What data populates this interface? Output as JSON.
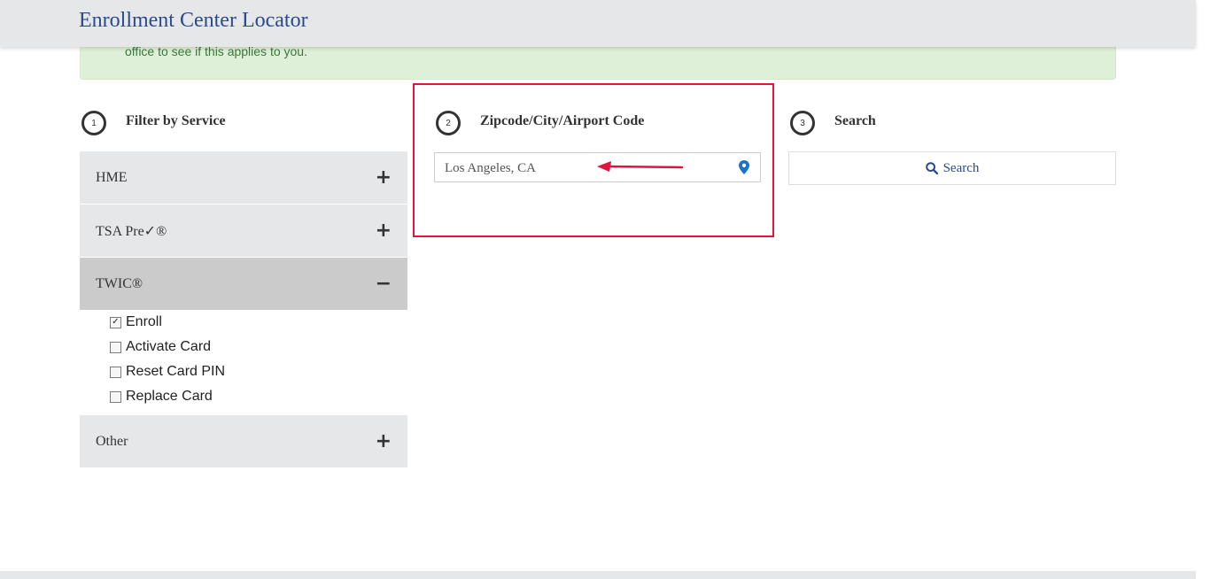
{
  "header": {
    "title": "Enrollment Center Locator"
  },
  "alert": {
    "text": "office to see if this applies to you."
  },
  "steps": [
    {
      "number": "1",
      "label": "Filter by Service"
    },
    {
      "number": "2",
      "label": "Zipcode/City/Airport Code"
    },
    {
      "number": "3",
      "label": "Search"
    }
  ],
  "services": {
    "items": [
      {
        "label": "HME",
        "icon": "+"
      },
      {
        "label": "TSA Pre✓®",
        "icon": "+"
      },
      {
        "label": "TWIC®",
        "icon": "−"
      },
      {
        "label": "Other",
        "icon": "+"
      }
    ],
    "twic_options": [
      {
        "label": "Enroll",
        "checked": true
      },
      {
        "label": "Activate Card",
        "checked": false
      },
      {
        "label": "Reset Card PIN",
        "checked": false
      },
      {
        "label": "Replace Card",
        "checked": false
      }
    ]
  },
  "location": {
    "value": "Los Angeles, CA"
  },
  "search": {
    "label": "Search"
  },
  "colors": {
    "accent": "#2b4a8b",
    "highlight": "#e4123d",
    "pin": "#1a73c6"
  }
}
